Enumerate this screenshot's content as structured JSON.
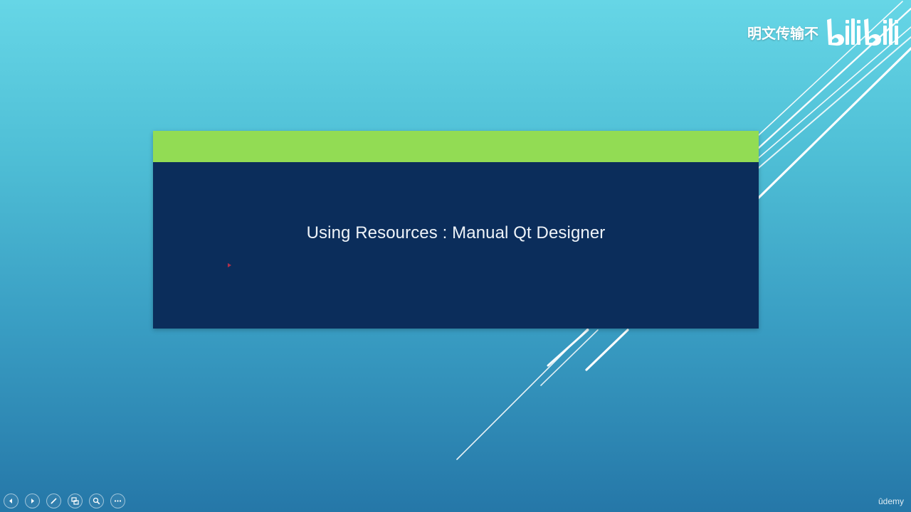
{
  "slide": {
    "title": "Using Resources : Manual Qt Designer",
    "header_bar_color": "#92dc54",
    "body_color": "#0b2d5b"
  },
  "watermark": {
    "text": "明文传输不",
    "logo": "bilibili"
  },
  "controls": [
    {
      "name": "previous-slide-button",
      "icon": "arrow-left-icon"
    },
    {
      "name": "next-slide-button",
      "icon": "arrow-right-icon"
    },
    {
      "name": "pen-tool-button",
      "icon": "pen-icon"
    },
    {
      "name": "slides-overview-button",
      "icon": "slides-icon"
    },
    {
      "name": "zoom-button",
      "icon": "magnifier-icon"
    },
    {
      "name": "more-options-button",
      "icon": "ellipsis-icon"
    }
  ],
  "brand": {
    "udemy": "ûdemy"
  }
}
